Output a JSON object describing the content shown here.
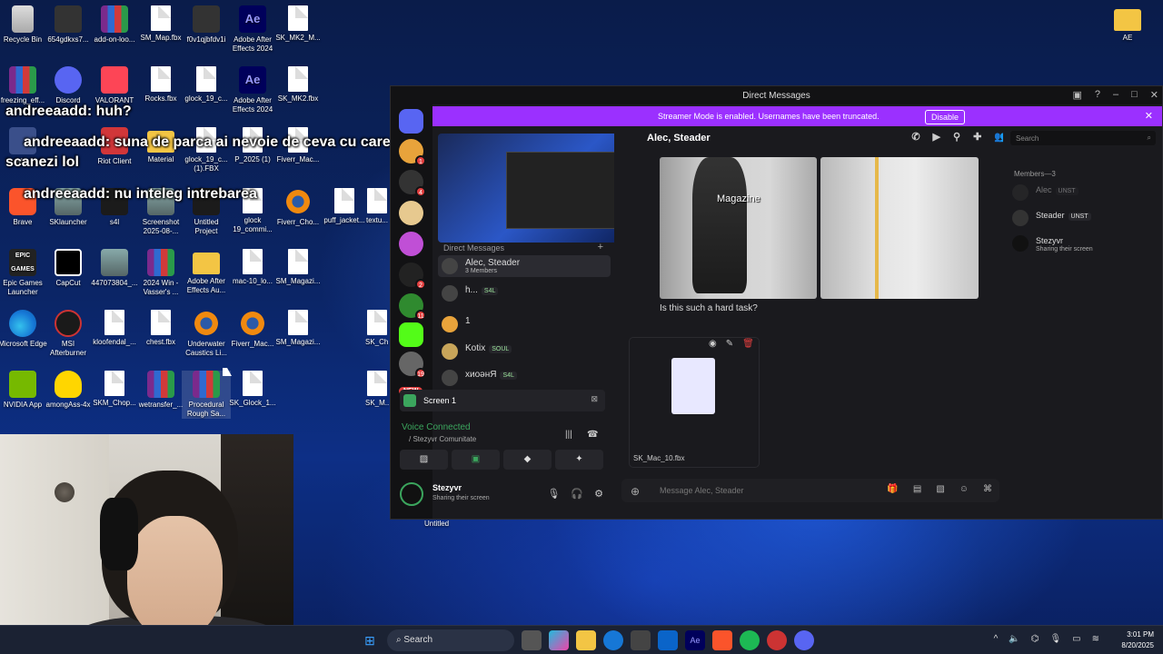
{
  "desktop": {
    "icons": [
      {
        "label": "Recycle Bin"
      },
      {
        "label": "654gdkxs7..."
      },
      {
        "label": "add-on-loo..."
      },
      {
        "label": "SM_Map.fbx"
      },
      {
        "label": "f0v1qjbfdv1i"
      },
      {
        "label": "Adobe After Effects 2024"
      },
      {
        "label": "SK_MK2_M..."
      },
      {
        "label": "freezing_eff..."
      },
      {
        "label": "Discord"
      },
      {
        "label": "VALORANT"
      },
      {
        "label": "Rocks.fbx"
      },
      {
        "label": "glock_19_c..."
      },
      {
        "label": "Adobe After Effects 2024"
      },
      {
        "label": "SK_MK2.fbx"
      },
      {
        "label": "M..."
      },
      {
        "label": "Riot Client"
      },
      {
        "label": "Material"
      },
      {
        "label": "glock_19_c... (1).FBX"
      },
      {
        "label": "P_2025 (1)"
      },
      {
        "label": "Fiverr_Mac..."
      },
      {
        "label": "Brave"
      },
      {
        "label": "SKlauncher"
      },
      {
        "label": "s4l"
      },
      {
        "label": "Screenshot 2025-08-..."
      },
      {
        "label": "Untitled Project"
      },
      {
        "label": "glock 19_commi..."
      },
      {
        "label": "Fiverr_Cho..."
      },
      {
        "label": "puff_jacket..."
      },
      {
        "label": "textu..."
      },
      {
        "label": "Epic Games Launcher"
      },
      {
        "label": "CapCut"
      },
      {
        "label": "447073804_..."
      },
      {
        "label": "2024 Win - Vasser's ..."
      },
      {
        "label": "Adobe After Effects Au..."
      },
      {
        "label": "mac-10_lo..."
      },
      {
        "label": "SM_Magazi..."
      },
      {
        "label": "Microsoft Edge"
      },
      {
        "label": "MSI Afterburner"
      },
      {
        "label": "kloofendal_..."
      },
      {
        "label": "chest.fbx"
      },
      {
        "label": "Underwater Caustics Li..."
      },
      {
        "label": "Fiverr_Mac..."
      },
      {
        "label": "SM_Magazi..."
      },
      {
        "label": "SK_Ch..."
      },
      {
        "label": "NVIDIA App"
      },
      {
        "label": "amongAss-4x"
      },
      {
        "label": "SKM_Chop..."
      },
      {
        "label": "wetransfer_..."
      },
      {
        "label": "Procedural Rough Sa..."
      },
      {
        "label": "SK_Glock_1..."
      },
      {
        "label": "SK_M..."
      },
      {
        "label": "AE"
      }
    ],
    "untitled_label": "Untitled"
  },
  "overlay_chat": {
    "line1": "andreeaadd: huh?",
    "line2": "andreeaadd: suna de parca ai nevoie de ceva cu care sa",
    "line3": "scanezi lol",
    "line4": "andreeaadd: nu inteleg intrebarea"
  },
  "discord": {
    "window_title": "Direct Messages",
    "streamer_banner": "Streamer Mode is enabled. Usernames have been truncated.",
    "disable_label": "Disable",
    "servers": [
      {
        "badge": "1"
      },
      {
        "badge": "4"
      },
      {
        "badge": ""
      },
      {
        "badge": ""
      },
      {
        "badge": "2"
      },
      {
        "badge": "11"
      },
      {
        "badge": ""
      },
      {
        "badge": "19"
      }
    ],
    "new_label": "NEW",
    "dm_header": "Direct Messages",
    "dms": [
      {
        "name": "Alec, Steader",
        "sub": "3 Members"
      },
      {
        "name": "h...",
        "tag": "S4L"
      },
      {
        "name": "1"
      },
      {
        "name": "Kotix",
        "tag": "SOUL"
      },
      {
        "name": "хиоәнЯ",
        "tag": "S4L"
      }
    ],
    "screen_share_label": "Screen 1",
    "voice_status": "Voice Connected",
    "voice_channel": "/ Stezyvr Comunitate",
    "user": {
      "name": "Stezyvr",
      "status": "Sharing their screen"
    },
    "chat": {
      "title": "Alec, Steader",
      "image_label": "Magazine",
      "message": "Is this such a hard task?",
      "attachment_name": "SK_Mac_10.fbx",
      "input_placeholder": "Message Alec, Steader"
    },
    "search_placeholder": "Search",
    "members_header": "Members—3",
    "members": [
      {
        "name": "Alec",
        "tag": "UNST"
      },
      {
        "name": "Steader",
        "tag": "UNST"
      },
      {
        "name": "Stezyvr",
        "sub": "Sharing their screen"
      }
    ]
  },
  "taskbar": {
    "search_label": "Search",
    "time": "3:01 PM",
    "date": "8/20/2025"
  }
}
